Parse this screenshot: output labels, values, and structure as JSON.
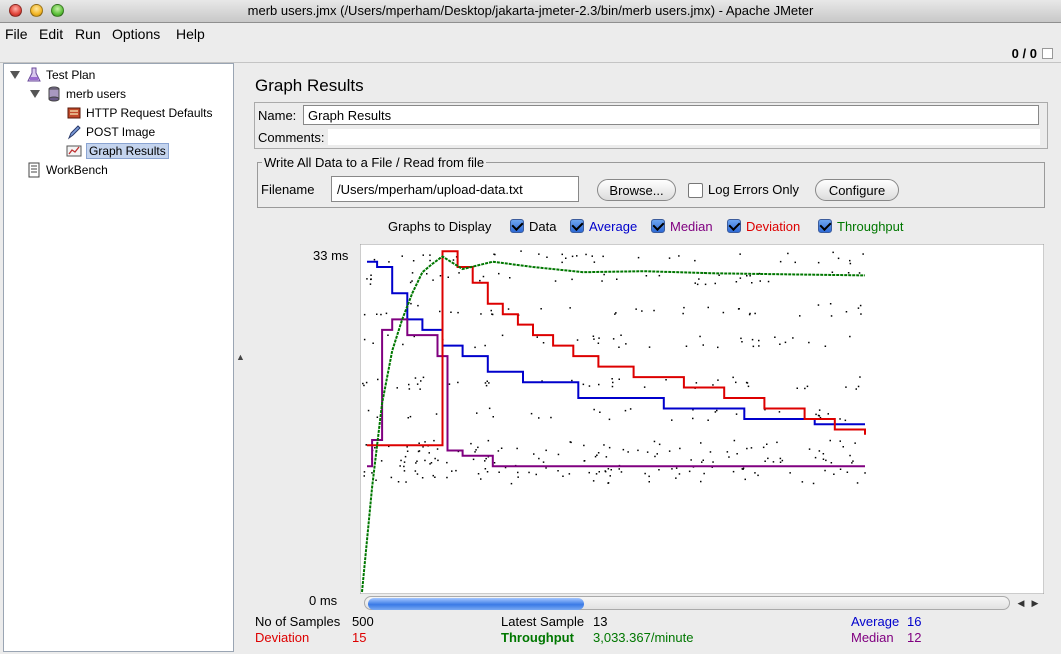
{
  "window": {
    "title": "merb users.jmx (/Users/mperham/Desktop/jakarta-jmeter-2.3/bin/merb users.jmx) - Apache JMeter"
  },
  "menu": [
    "File",
    "Edit",
    "Run",
    "Options",
    "Help"
  ],
  "status": {
    "active_threads": "0",
    "separator": "/",
    "total_threads": "0"
  },
  "tree": {
    "items": [
      {
        "label": "Test Plan",
        "icon": "flask-icon",
        "expanded": true
      },
      {
        "label": "merb users",
        "icon": "thread-group-icon",
        "expanded": true
      },
      {
        "label": "HTTP Request Defaults",
        "icon": "config-icon"
      },
      {
        "label": "POST Image",
        "icon": "sampler-icon"
      },
      {
        "label": "Graph Results",
        "icon": "graph-icon",
        "selected": true
      },
      {
        "label": "WorkBench",
        "icon": "workbench-icon"
      }
    ]
  },
  "panel": {
    "title": "Graph Results",
    "name_label": "Name:",
    "name_value": "Graph Results",
    "comments_label": "Comments:",
    "comments_value": ""
  },
  "file": {
    "legend": "Write All Data to a File / Read from file",
    "filename_label": "Filename",
    "filename_value": "/Users/mperham/upload-data.txt",
    "browse_label": "Browse...",
    "log_errors_label": "Log Errors Only",
    "log_errors_checked": false,
    "configure_label": "Configure"
  },
  "graphs": {
    "label": "Graphs to Display",
    "options": [
      {
        "label": "Data",
        "checked": true,
        "color": "#000000"
      },
      {
        "label": "Average",
        "checked": true,
        "color": "#0000cc"
      },
      {
        "label": "Median",
        "checked": true,
        "color": "#800080"
      },
      {
        "label": "Deviation",
        "checked": true,
        "color": "#dd0000"
      },
      {
        "label": "Throughput",
        "checked": true,
        "color": "#007700"
      }
    ]
  },
  "chart_data": {
    "type": "scatter",
    "y_max_label": "33 ms",
    "y_min_label": "0 ms",
    "ylim": [
      0,
      33
    ],
    "sample_count": 500,
    "series": [
      {
        "name": "Average",
        "color": "#0000cc",
        "x": [
          5,
          15,
          30,
          45,
          60,
          80,
          100,
          125,
          160,
          215,
          300,
          380,
          450,
          500
        ],
        "y": [
          31.5,
          31,
          28.5,
          26,
          25,
          23.5,
          22.5,
          21,
          20,
          18.5,
          17.5,
          16.5,
          16,
          16
        ]
      },
      {
        "name": "Median",
        "color": "#800080",
        "x": [
          5,
          10,
          20,
          30,
          45,
          60,
          75,
          85,
          100,
          130,
          500
        ],
        "y": [
          12,
          14.5,
          25,
          26,
          24.5,
          24.5,
          22.5,
          13.5,
          13,
          12,
          12
        ]
      },
      {
        "name": "Deviation",
        "color": "#dd0000",
        "x": [
          5,
          80,
          95,
          110,
          125,
          140,
          155,
          170,
          190,
          210,
          235,
          270,
          320,
          360,
          400,
          440,
          470,
          500
        ],
        "y": [
          14,
          32.5,
          31,
          29.5,
          27.5,
          26.5,
          25.5,
          24.5,
          23.5,
          22.5,
          21.5,
          20.5,
          19.5,
          18.5,
          17.5,
          16.5,
          15.5,
          15
        ]
      },
      {
        "name": "Throughput",
        "color": "#007700",
        "x": [
          0,
          10,
          20,
          30,
          40,
          50,
          60,
          70,
          80,
          100,
          130,
          170,
          220,
          280,
          350,
          420,
          500
        ],
        "y": [
          0,
          10,
          18,
          23,
          26,
          28.5,
          30.5,
          31.3,
          32,
          30.8,
          31.5,
          31,
          30.5,
          30.6,
          30.4,
          30.3,
          30.2
        ]
      }
    ]
  },
  "stats": {
    "no_of_samples_label": "No of Samples",
    "no_of_samples": "500",
    "latest_sample_label": "Latest Sample",
    "latest_sample": "13",
    "average_label": "Average",
    "average": "16",
    "deviation_label": "Deviation",
    "deviation": "15",
    "throughput_label": "Throughput",
    "throughput": "3,033.367/minute",
    "median_label": "Median",
    "median": "12"
  }
}
